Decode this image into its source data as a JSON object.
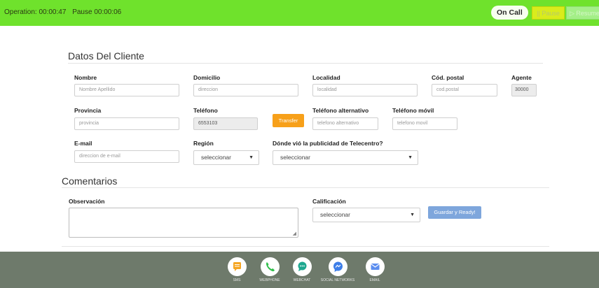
{
  "topbar": {
    "operation": "Operation: 00:00:47",
    "pause": "Pause 00:00:06",
    "status": "On Call",
    "pause_btn": "|| Pause",
    "resume_btn": "▷ Resume"
  },
  "client": {
    "title": "Datos Del Cliente",
    "nombre": {
      "label": "Nombre",
      "placeholder": "Nombre Apellido"
    },
    "domicilio": {
      "label": "Domicilio",
      "placeholder": "direccion"
    },
    "localidad": {
      "label": "Localidad",
      "placeholder": "localidad"
    },
    "cod_postal": {
      "label": "Cód. postal",
      "placeholder": "cod.postal"
    },
    "agente": {
      "label": "Agente",
      "value": "30000"
    },
    "provincia": {
      "label": "Provincia",
      "placeholder": "provincia"
    },
    "telefono": {
      "label": "Teléfono",
      "value": "6553103"
    },
    "transfer_btn": "Transfer",
    "tel_alt": {
      "label": "Teléfono alternativo",
      "placeholder": "telefono alternativo"
    },
    "tel_movil": {
      "label": "Teléfono móvil",
      "placeholder": "telefono movil"
    },
    "email": {
      "label": "E-mail",
      "placeholder": "direccion de e-mail"
    },
    "region": {
      "label": "Región",
      "value": "seleccionar"
    },
    "publicidad": {
      "label": "Dónde vió la publicidad de Telecentro?",
      "value": "seleccionar"
    }
  },
  "comments": {
    "title": "Comentarios",
    "observacion_label": "Observación",
    "calificacion": {
      "label": "Calificación",
      "value": "seleccionar"
    },
    "save_btn": "Guardar y Ready!"
  },
  "footer": {
    "channels": [
      {
        "label": "SMS",
        "icon": "sms-icon",
        "color": "#f5a623"
      },
      {
        "label": "WEBPHONE",
        "icon": "phone-icon",
        "color": "#2fbf4a"
      },
      {
        "label": "WEBCHAT",
        "icon": "chat-icon",
        "color": "#1fa890"
      },
      {
        "label": "SOCIAL NETWORKS",
        "icon": "messenger-icon",
        "color": "#3d7ee8"
      },
      {
        "label": "EMAIL",
        "icon": "email-icon",
        "color": "#5b8def"
      }
    ]
  }
}
